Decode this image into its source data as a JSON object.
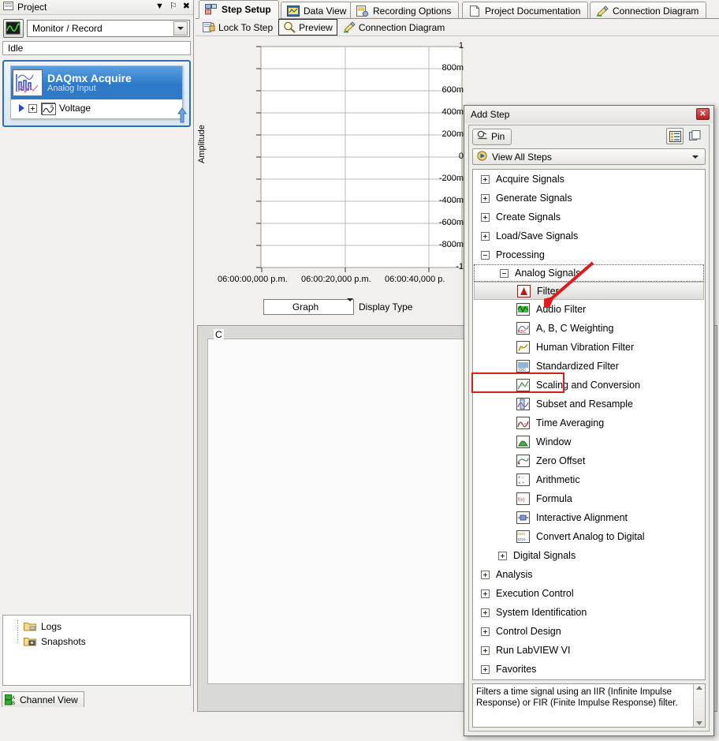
{
  "project": {
    "title": "Project",
    "title_icon": "project-icon",
    "controls": [
      {
        "name": "dropdown-caret-icon",
        "glyph": "▼"
      },
      {
        "name": "pin-icon",
        "glyph": "⚐"
      },
      {
        "name": "close-icon",
        "glyph": "✖"
      }
    ],
    "mode_combo": {
      "value": "Monitor / Record",
      "icon": "waveform-icon"
    },
    "status": "Idle",
    "task": {
      "title": "DAQmx Acquire",
      "subtitle": "Analog Input",
      "channel": "Voltage"
    },
    "logs_tree": [
      {
        "label": "Logs",
        "icon": "folder-logs-icon"
      },
      {
        "label": "Snapshots",
        "icon": "folder-snapshots-icon"
      }
    ],
    "bottom_tab": {
      "label": "Channel View",
      "icon": "channel-view-icon"
    }
  },
  "main": {
    "tabs": [
      {
        "label": "Step Setup",
        "icon": "step-setup-icon",
        "active": true
      },
      {
        "label": "Data View",
        "icon": "data-view-icon",
        "active": false
      },
      {
        "label": "Recording Options",
        "icon": "recording-options-icon",
        "active": false
      },
      {
        "label": "Project Documentation",
        "icon": "project-documentation-icon",
        "active": false
      },
      {
        "label": "Connection Diagram",
        "icon": "connection-diagram-icon",
        "active": false
      }
    ],
    "toolbar": [
      {
        "label": "Lock To Step",
        "icon": "lock-to-step-icon",
        "boxed": false
      },
      {
        "label": "Preview",
        "icon": "preview-magnifier-icon",
        "boxed": true
      },
      {
        "label": "Connection Diagram",
        "icon": "connection-diagram-icon",
        "boxed": false
      }
    ],
    "display_type": {
      "value": "Graph",
      "label": "Display Type"
    },
    "lower_panel_label": "C"
  },
  "chart_data": {
    "type": "line",
    "title": "",
    "xlabel": "",
    "ylabel": "Amplitude",
    "series": [],
    "grid": true,
    "ylim": [
      -1,
      1
    ],
    "yticks": [
      "1",
      "800m",
      "600m",
      "400m",
      "200m",
      "0",
      "-200m",
      "-400m",
      "-600m",
      "-800m",
      "-1"
    ],
    "yvalues": [
      1,
      0.8,
      0.6,
      0.4,
      0.2,
      0,
      -0.2,
      -0.4,
      -0.6,
      -0.8,
      -1
    ],
    "xticks": [
      "06:00:00,000 p.m.",
      "06:00:20,000 p.m.",
      "06:00:40,000 p."
    ],
    "legend": "none"
  },
  "add_step": {
    "title": "Add Step",
    "close_glyph": "✕",
    "pin_button": {
      "label": "Pin",
      "icon": "pin-icon"
    },
    "tool_buttons": [
      {
        "name": "list-view-icon"
      },
      {
        "name": "copy-icon"
      }
    ],
    "view_selector": {
      "label": "View All Steps",
      "icon": "view-steps-icon"
    },
    "tree": [
      {
        "label": "Acquire Signals",
        "kind": "category",
        "state": "collapsed",
        "indent": 0
      },
      {
        "label": "Generate Signals",
        "kind": "category",
        "state": "collapsed",
        "indent": 0
      },
      {
        "label": "Create Signals",
        "kind": "category",
        "state": "collapsed",
        "indent": 0
      },
      {
        "label": "Load/Save Signals",
        "kind": "category",
        "state": "collapsed",
        "indent": 0
      },
      {
        "label": "Processing",
        "kind": "category",
        "state": "expanded",
        "indent": 0,
        "highlight": "red-box"
      },
      {
        "label": "Analog Signals",
        "kind": "category",
        "state": "expanded",
        "indent": 1,
        "highlight": "dotted-focus"
      },
      {
        "label": "Filter",
        "kind": "step",
        "icon": "filter-icon",
        "indent": 2,
        "highlight": "selected"
      },
      {
        "label": "Audio Filter",
        "kind": "step",
        "icon": "audio-filter-icon",
        "indent": 2
      },
      {
        "label": "A, B, C Weighting",
        "kind": "step",
        "icon": "abc-weighting-icon",
        "indent": 2
      },
      {
        "label": "Human Vibration Filter",
        "kind": "step",
        "icon": "human-vibration-filter-icon",
        "indent": 2
      },
      {
        "label": "Standardized Filter",
        "kind": "step",
        "icon": "standardized-filter-icon",
        "indent": 2
      },
      {
        "label": "Scaling and Conversion",
        "kind": "step",
        "icon": "scaling-conversion-icon",
        "indent": 2
      },
      {
        "label": "Subset and Resample",
        "kind": "step",
        "icon": "subset-resample-icon",
        "indent": 2
      },
      {
        "label": "Time Averaging",
        "kind": "step",
        "icon": "time-averaging-icon",
        "indent": 2
      },
      {
        "label": "Window",
        "kind": "step",
        "icon": "window-icon",
        "indent": 2
      },
      {
        "label": "Zero Offset",
        "kind": "step",
        "icon": "zero-offset-icon",
        "indent": 2
      },
      {
        "label": "Arithmetic",
        "kind": "step",
        "icon": "arithmetic-icon",
        "indent": 2
      },
      {
        "label": "Formula",
        "kind": "step",
        "icon": "formula-icon",
        "indent": 2
      },
      {
        "label": "Interactive Alignment",
        "kind": "step",
        "icon": "interactive-alignment-icon",
        "indent": 2
      },
      {
        "label": "Convert Analog to Digital",
        "kind": "step",
        "icon": "convert-analog-digital-icon",
        "indent": 2
      },
      {
        "label": "Digital Signals",
        "kind": "category",
        "state": "collapsed",
        "indent": 1
      },
      {
        "label": "Analysis",
        "kind": "category",
        "state": "collapsed",
        "indent": 0
      },
      {
        "label": "Execution Control",
        "kind": "category",
        "state": "collapsed",
        "indent": 0
      },
      {
        "label": "System Identification",
        "kind": "category",
        "state": "collapsed",
        "indent": 0
      },
      {
        "label": "Control Design",
        "kind": "category",
        "state": "collapsed",
        "indent": 0
      },
      {
        "label": "Run LabVIEW VI",
        "kind": "category",
        "state": "collapsed",
        "indent": 0
      },
      {
        "label": "Favorites",
        "kind": "category",
        "state": "collapsed",
        "indent": 0
      }
    ],
    "description": "Filters a time signal using an IIR (Infinite Impulse Response) or FIR (Finite Impulse Response) filter."
  },
  "annotation": {
    "arrow_color": "#e01b1b"
  },
  "colors": {
    "accent_blue": "#2f7ac8",
    "selection_border": "#2f6fb5",
    "red_highlight": "#d32020",
    "window_bg": "#f1f0ee"
  }
}
